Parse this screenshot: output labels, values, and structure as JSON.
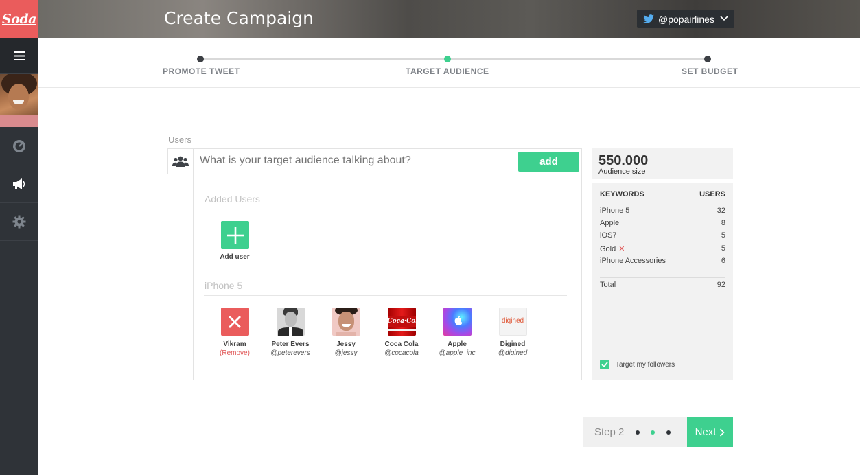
{
  "app": {
    "logo_text": "Soda",
    "accent_color": "#3ed08f",
    "brand_color": "#ea5c5c"
  },
  "header": {
    "title": "Create Campaign",
    "account_handle": "@popairlines",
    "account_icon": "twitter-icon"
  },
  "sidebar": {
    "items": [
      {
        "icon": "hamburger-menu-icon"
      },
      {
        "icon": "dashboard-gauge-icon"
      },
      {
        "icon": "megaphone-icon"
      },
      {
        "icon": "gear-icon"
      }
    ]
  },
  "stepper": {
    "steps": [
      {
        "label": "PROMOTE TWEET",
        "active": false
      },
      {
        "label": "TARGET AUDIENCE",
        "active": true
      },
      {
        "label": "SET BUDGET",
        "active": false
      }
    ]
  },
  "users_panel": {
    "title": "Users",
    "search_placeholder": "What is your target audience talking about?",
    "add_label": "add",
    "added_users_title": "Added Users",
    "add_user_label": "Add user",
    "keyword_section_title": "iPhone 5",
    "users": [
      {
        "name": "Vikram",
        "handle": "(Remove)"
      },
      {
        "name": "Peter Evers",
        "handle": "@peterevers"
      },
      {
        "name": "Jessy",
        "handle": "@jessy"
      },
      {
        "name": "Coca Cola",
        "handle": "@cocacola"
      },
      {
        "name": "Apple",
        "handle": "@apple_inc"
      },
      {
        "name": "Digined",
        "handle": "@digined"
      }
    ]
  },
  "stats": {
    "audience_size": "550.000",
    "audience_label": "Audience size",
    "keywords_header": "KEYWORDS",
    "users_header": "USERS",
    "keywords": [
      {
        "name": "iPhone 5",
        "count": "32"
      },
      {
        "name": "Apple",
        "count": "8"
      },
      {
        "name": "iOS7",
        "count": "5"
      },
      {
        "name": "Gold",
        "count": "5",
        "removable": true
      },
      {
        "name": "iPhone Accessories",
        "count": "6"
      }
    ],
    "total_label": "Total",
    "total_value": "92",
    "followers_label": "Target my followers",
    "followers_checked": true
  },
  "footer": {
    "step_label": "Step 2",
    "next_label": "Next",
    "current_dot": 2,
    "dot_count": 3
  }
}
